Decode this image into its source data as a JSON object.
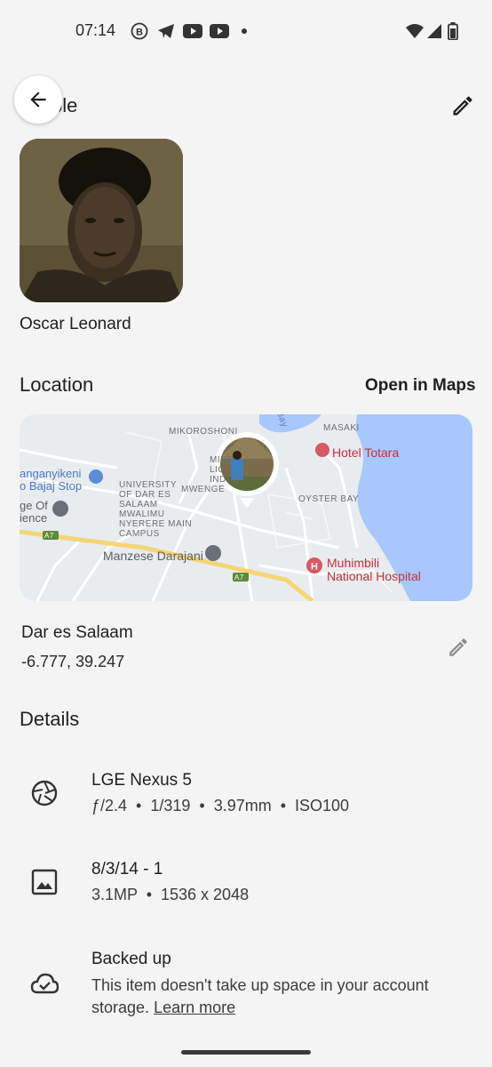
{
  "status_bar": {
    "time": "07:14",
    "notification_icons": [
      "b-badge-icon",
      "telegram-icon",
      "youtube-icon",
      "youtube-icon",
      "dot-icon"
    ],
    "system_icons": [
      "wifi-icon",
      "signal-icon",
      "battery-icon"
    ]
  },
  "header": {
    "title_visible_fragment": "ple"
  },
  "person": {
    "name": "Oscar Leonard"
  },
  "location": {
    "section_title": "Location",
    "open_in_maps": "Open in Maps",
    "map_labels": {
      "mikoroshoni": "MIKOROSHONI",
      "mikocheni_frag": "MIKO\nLIG\nINDUS",
      "mwenge": "MWENGE",
      "masaki": "MASAKI",
      "hotel": "Hotel Totara",
      "bajaj": "anganyikeni\no Bajaj Stop",
      "university": "UNIVERSITY\nOF DAR ES\nSALAAM\nMWALIMU\nNYERERE MAIN\nCAMPUS",
      "science": "ge Of\nience",
      "oyster_bay": "OYSTER BAY",
      "manzese": "Manzese Darajani",
      "hospital": "Muhimbili\nNational Hospital",
      "road_a7_left": "A7",
      "road_a7_right": "A7",
      "bay": "Bay"
    },
    "place_name": "Dar es Salaam",
    "coordinates": "-6.777, 39.247"
  },
  "details": {
    "section_title": "Details",
    "items": [
      {
        "icon": "camera-aperture-icon",
        "title": "LGE Nexus 5",
        "subtitle": "ƒ/2.4  •  1/319  •  3.97mm  •  ISO100"
      },
      {
        "icon": "image-icon",
        "title": "8/3/14 - 1",
        "subtitle": "3.1MP  •  1536 x 2048"
      },
      {
        "icon": "cloud-check-icon",
        "title": "Backed up",
        "subtitle": "This item doesn't take up space in your account storage.",
        "link": "Learn more"
      }
    ]
  },
  "colors": {
    "background": "#f4f4f4",
    "water": "#a8c7fa",
    "map_land": "#e9ecef",
    "highway": "#f4d675",
    "poi_red": "#c5303a"
  }
}
